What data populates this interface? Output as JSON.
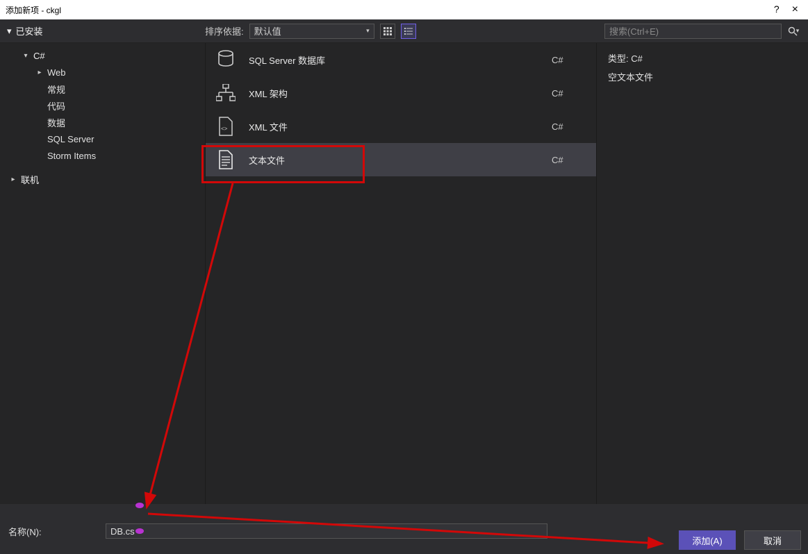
{
  "titlebar": {
    "title": "添加新项 - ckgl",
    "help": "?",
    "close": "×"
  },
  "toolbar": {
    "installed_header": "已安装",
    "sort_label": "排序依据:",
    "sort_value": "默认值",
    "search_placeholder": "搜索(Ctrl+E)"
  },
  "tree": {
    "items": [
      {
        "label": "C#",
        "level": 1,
        "expandable": true,
        "expanded": true
      },
      {
        "label": "Web",
        "level": 2,
        "expandable": true,
        "expanded": false
      },
      {
        "label": "常规",
        "level": 2,
        "expandable": false
      },
      {
        "label": "代码",
        "level": 2,
        "expandable": false
      },
      {
        "label": "数据",
        "level": 2,
        "expandable": false
      },
      {
        "label": "SQL Server",
        "level": 2,
        "expandable": false
      },
      {
        "label": "Storm Items",
        "level": 2,
        "expandable": false
      }
    ],
    "online": "联机"
  },
  "templates": [
    {
      "name": "SQL Server 数据库",
      "lang": "C#",
      "icon": "database"
    },
    {
      "name": "XML 架构",
      "lang": "C#",
      "icon": "xml-schema"
    },
    {
      "name": "XML 文件",
      "lang": "C#",
      "icon": "xml-file"
    },
    {
      "name": "文本文件",
      "lang": "C#",
      "icon": "text-file",
      "selected": true
    }
  ],
  "detail": {
    "type_label": "类型:",
    "type_value": "C#",
    "description": "空文本文件"
  },
  "bottom": {
    "name_label": "名称(N):",
    "name_value": "DB.cs",
    "add_btn": "添加(A)",
    "cancel_btn": "取消"
  }
}
